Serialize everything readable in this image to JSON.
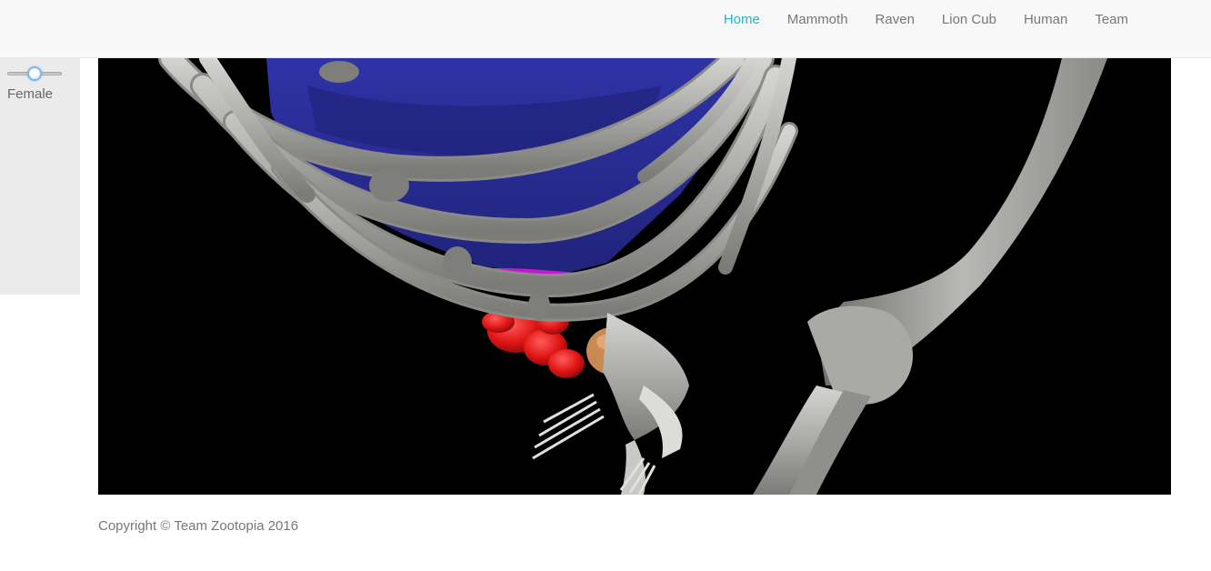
{
  "nav": {
    "items": [
      {
        "label": "Home",
        "active": true
      },
      {
        "label": "Mammoth",
        "active": false
      },
      {
        "label": "Raven",
        "active": false
      },
      {
        "label": "Lion Cub",
        "active": false
      },
      {
        "label": "Human",
        "active": false
      },
      {
        "label": "Team",
        "active": false
      }
    ]
  },
  "sidebar": {
    "slider": {
      "label": "Female",
      "value": 0.5
    }
  },
  "viewer": {
    "background": "#000000"
  },
  "footer": {
    "copyright": "Copyright © Team Zootopia 2016"
  },
  "colors": {
    "accent": "#26b3c5",
    "nav_text": "#777777",
    "bone": "#b9b9b6",
    "lungs": "#2b2e96",
    "diaphragm": "#c21bc9",
    "organ_red": "#e01515",
    "organ_tan": "#c98a52"
  }
}
